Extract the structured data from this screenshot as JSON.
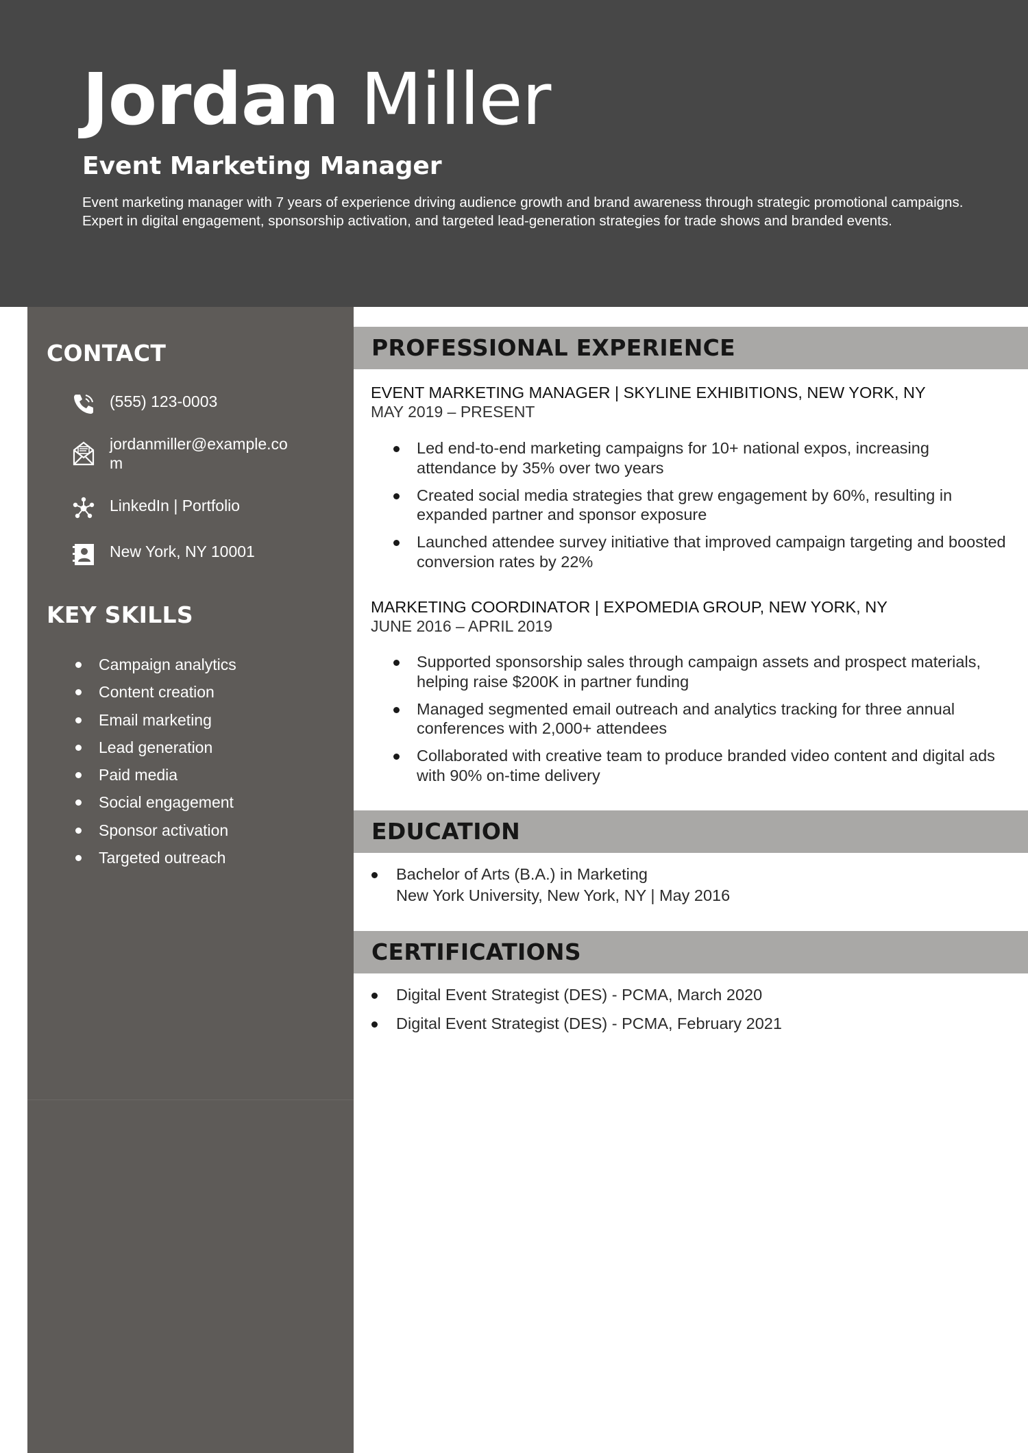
{
  "header": {
    "first_name": "Jordan",
    "last_name": "Miller",
    "job_title": "Event Marketing Manager",
    "summary": "Event marketing manager with 7 years of experience driving audience growth and brand awareness through strategic promotional campaigns. Expert in digital engagement, sponsorship activation, and targeted lead-generation strategies for trade shows and branded events."
  },
  "contact": {
    "heading": "CONTACT",
    "phone": "(555) 123-0003",
    "email": "jordanmiller@example.com",
    "links": "LinkedIn | Portfolio",
    "location": "New York, NY 10001",
    "icons": [
      "phone-icon",
      "envelope-icon",
      "network-icon",
      "address-card-icon"
    ]
  },
  "skills": {
    "heading": "KEY SKILLS",
    "items": [
      "Campaign analytics",
      "Content creation",
      "Email marketing",
      "Lead generation",
      "Paid media",
      "Social engagement",
      "Sponsor activation",
      "Targeted outreach"
    ]
  },
  "experience": {
    "heading": "PROFESSIONAL EXPERIENCE",
    "jobs": [
      {
        "title_line": "EVENT MARKETING MANAGER | SKYLINE EXHIBITIONS, NEW YORK, NY",
        "dates": "MAY 2019 – PRESENT",
        "bullets": [
          "Led end-to-end marketing campaigns for 10+ national expos, increasing attendance by 35% over two years",
          "Created social media strategies that grew engagement by 60%, resulting in expanded partner and sponsor exposure",
          "Launched attendee survey initiative that improved campaign targeting and boosted conversion rates by 22%"
        ]
      },
      {
        "title_line": "MARKETING COORDINATOR | EXPOMEDIA GROUP, NEW YORK, NY",
        "dates": "JUNE 2016 – APRIL 2019",
        "bullets": [
          "Supported sponsorship sales through campaign assets and prospect materials, helping raise $200K in partner funding",
          "Managed segmented email outreach and analytics tracking for three annual conferences with 2,000+ attendees",
          "Collaborated with creative team to produce branded video content and digital ads with 90% on-time delivery"
        ]
      }
    ]
  },
  "education": {
    "heading": "EDUCATION",
    "degree": "Bachelor of Arts (B.A.) in Marketing",
    "school": "New York University, New York, NY | May 2016"
  },
  "certifications": {
    "heading": "CERTIFICATIONS",
    "items": [
      "Digital Event Strategist (DES) - PCMA, March 2020",
      "Digital Event Strategist (DES) - PCMA, February 2021"
    ]
  },
  "colors": {
    "header_bg": "#474747",
    "sidebar_bg": "#5e5b58",
    "section_band": "#a9a8a6"
  }
}
